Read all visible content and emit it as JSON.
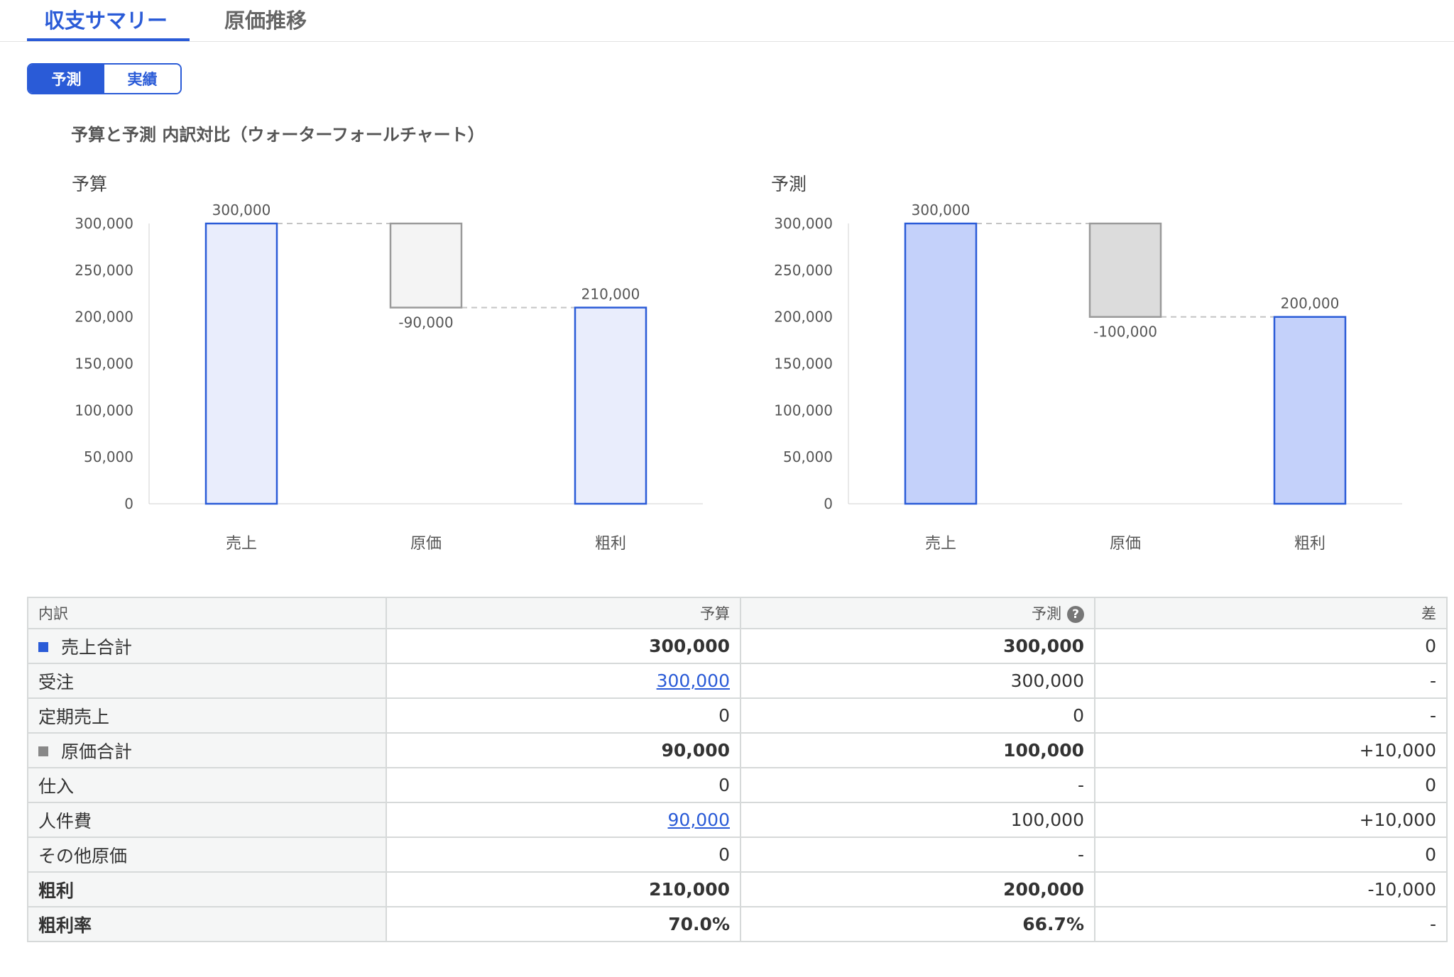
{
  "tabs": [
    {
      "label": "収支サマリー",
      "active": true
    },
    {
      "label": "原価推移",
      "active": false
    }
  ],
  "toggle": {
    "on": "予測",
    "off": "実績"
  },
  "chart_title": "予算と予測 内訳対比（ウォーターフォールチャート）",
  "chart_data": [
    {
      "type": "bar",
      "subtitle": "予算",
      "categories": [
        "売上",
        "原価",
        "粗利"
      ],
      "values": [
        300000,
        -90000,
        210000
      ],
      "data_labels": [
        "300,000",
        "-90,000",
        "210,000"
      ],
      "ylim": [
        0,
        300000
      ],
      "yticks": [
        "0",
        "50,000",
        "100,000",
        "150,000",
        "200,000",
        "250,000",
        "300,000"
      ],
      "colors": {
        "fill": "#e9edfc",
        "stroke": "#2a5bd7",
        "cost_fill": "#f4f4f4",
        "cost_stroke": "#9a9a9a"
      }
    },
    {
      "type": "bar",
      "subtitle": "予測",
      "categories": [
        "売上",
        "原価",
        "粗利"
      ],
      "values": [
        300000,
        -100000,
        200000
      ],
      "data_labels": [
        "300,000",
        "-100,000",
        "200,000"
      ],
      "ylim": [
        0,
        300000
      ],
      "yticks": [
        "0",
        "50,000",
        "100,000",
        "150,000",
        "200,000",
        "250,000",
        "300,000"
      ],
      "colors": {
        "fill": "#c4d1fa",
        "stroke": "#2a5bd7",
        "cost_fill": "#dcdcdc",
        "cost_stroke": "#9a9a9a"
      }
    }
  ],
  "table": {
    "headers": {
      "label": "内訳",
      "budget": "予算",
      "forecast": "予測",
      "diff": "差"
    },
    "help_icon": "question-circle-icon",
    "rows": [
      {
        "label": "売上合計",
        "budget": "300,000",
        "forecast": "300,000",
        "diff": "0"
      },
      {
        "label": "受注",
        "budget": "300,000",
        "forecast": "300,000",
        "diff": "-"
      },
      {
        "label": "定期売上",
        "budget": "0",
        "forecast": "0",
        "diff": "-"
      },
      {
        "label": "原価合計",
        "budget": "90,000",
        "forecast": "100,000",
        "diff": "+10,000"
      },
      {
        "label": "仕入",
        "budget": "0",
        "forecast": "-",
        "diff": "0"
      },
      {
        "label": "人件費",
        "budget": "90,000",
        "forecast": "100,000",
        "diff": "+10,000"
      },
      {
        "label": "その他原価",
        "budget": "0",
        "forecast": "-",
        "diff": "0"
      },
      {
        "label": "粗利",
        "budget": "210,000",
        "forecast": "200,000",
        "diff": "-10,000"
      },
      {
        "label": "粗利率",
        "budget": "70.0%",
        "forecast": "66.7%",
        "diff": "-"
      }
    ],
    "legend_colors": {
      "sales": "#2a5bd7",
      "cost": "#888888"
    }
  }
}
